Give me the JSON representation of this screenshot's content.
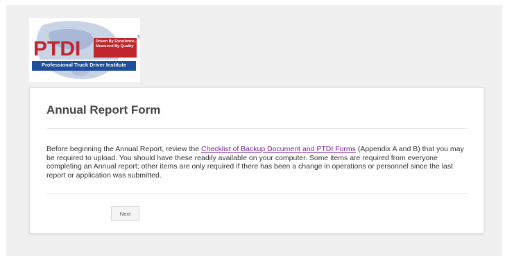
{
  "logo": {
    "mark": "PTDI",
    "tagline_line1": "Driven By Excellence...",
    "tagline_line2": "Measured By Quality",
    "banner": "Professional Truck Driver Institute",
    "reg": "®"
  },
  "form": {
    "title": "Annual Report Form",
    "intro_before": "Before beginning the Annual Report, review the ",
    "intro_link": "Checklist of Backup Document and PTDI Forms",
    "intro_after": " (Appendix A and B) that you may be required to upload. You should have these readily available on your computer. Some items are required from everyone completing an Annual report; other items are only required if there has been a change in operations or personnel since the last report or application was submitted.",
    "next_label": "Next"
  },
  "colors": {
    "brand_red": "#c0272d",
    "brand_blue": "#1f4e9b",
    "link": "#7b1fa2"
  }
}
